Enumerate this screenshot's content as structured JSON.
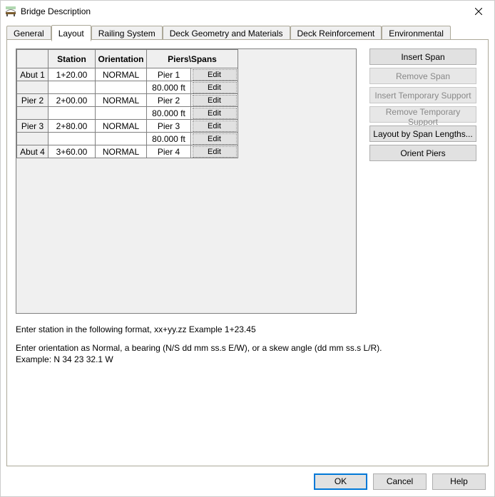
{
  "window": {
    "title": "Bridge Description"
  },
  "tabs": {
    "general": "General",
    "layout": "Layout",
    "railing": "Railing System",
    "deckgeom": "Deck Geometry and Materials",
    "deckreinf": "Deck Reinforcement",
    "environmental": "Environmental"
  },
  "grid": {
    "headers": {
      "station": "Station",
      "orientation": "Orientation",
      "piers": "Piers\\Spans"
    },
    "edit_label": "Edit",
    "rows": [
      {
        "rowhead": "Abut 1",
        "station": "1+20.00",
        "orientation": "NORMAL",
        "pier": "Pier 1"
      },
      {
        "rowhead": "",
        "span": "80.000 ft"
      },
      {
        "rowhead": "Pier 2",
        "station": "2+00.00",
        "orientation": "NORMAL",
        "pier": "Pier 2"
      },
      {
        "rowhead": "",
        "span": "80.000 ft"
      },
      {
        "rowhead": "Pier 3",
        "station": "2+80.00",
        "orientation": "NORMAL",
        "pier": "Pier 3"
      },
      {
        "rowhead": "",
        "span": "80.000 ft"
      },
      {
        "rowhead": "Abut 4",
        "station": "3+60.00",
        "orientation": "NORMAL",
        "pier": "Pier 4"
      }
    ]
  },
  "side_buttons": {
    "insert_span": "Insert Span",
    "remove_span": "Remove Span",
    "insert_temp": "Insert Temporary Support",
    "remove_temp": "Remove Temporary Support",
    "layout_by_span": "Layout by Span Lengths...",
    "orient_piers": "Orient Piers"
  },
  "help": {
    "line1": "Enter station in the following format, xx+yy.zz  Example 1+23.45",
    "line2": "Enter orientation as Normal, a bearing (N/S dd mm ss.s E/W), or a skew angle (dd mm ss.s L/R).",
    "line3": "Example: N 34 23 32.1 W"
  },
  "bottom": {
    "ok": "OK",
    "cancel": "Cancel",
    "help": "Help"
  }
}
